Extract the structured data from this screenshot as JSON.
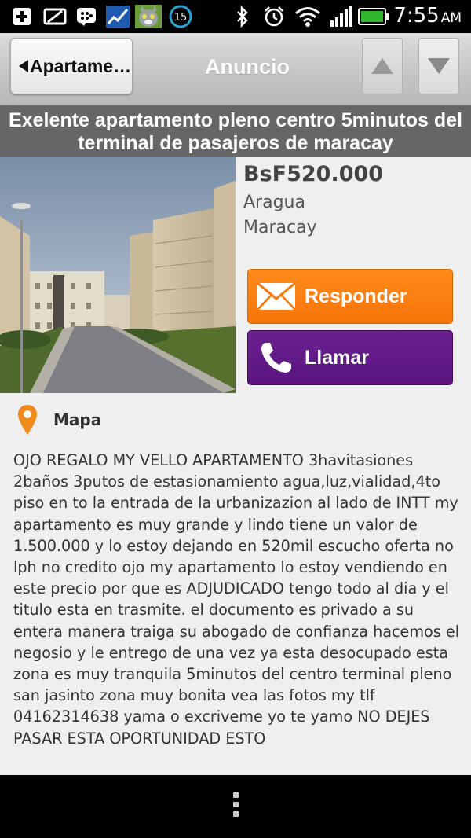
{
  "status_bar": {
    "time": "7:55",
    "ampm": "AM",
    "notification_count": "15",
    "icons": [
      "add-icon",
      "chat-icon",
      "bbm-icon",
      "chart-app-icon",
      "talking-cat-icon",
      "notification-count-icon",
      "bluetooth-icon",
      "alarm-icon",
      "wifi-icon",
      "signal-icon",
      "battery-icon"
    ]
  },
  "action_bar": {
    "back_label": "Apartame…",
    "title": "Anuncio"
  },
  "ad": {
    "title": "Exelente apartamento pleno centro 5minutos del terminal de pasajeros de maracay",
    "price": "BsF520.000",
    "state": "Aragua",
    "city": "Maracay",
    "reply_label": "Responder",
    "call_label": "Llamar",
    "map_label": "Mapa",
    "description": "OJO REGALO MY VELLO APARTAMENTO 3havitasiones 2baños 3putos de estasionamiento agua,luz,vialidad,4to piso en to la entrada de la urbanizazion al lado de INTT my apartamento es muy grande y lindo tiene un valor de 1.500.000 y lo estoy dejando en 520mil escucho oferta no lph no credito ojo my apartamento lo estoy vendiendo en este precio por que es  ADJUDICADO tengo todo al dia y el titulo esta en trasmite. el documento es privado a su entera manera traiga su abogado de confianza hacemos el negosio y le entrego de una vez ya esta desocupado esta zona es muy tranquila 5minutos del centro terminal pleno san jasinto zona muy bonita vea las fotos my tlf 04162314638 yama o excriveme yo te yamo  NO DEJES PASAR ESTA OPORTUNIDAD ESTO"
  },
  "colors": {
    "reply": "#f7790d",
    "call": "#5e1882",
    "title_bar": "#666666",
    "pin": "#f08a1c"
  }
}
